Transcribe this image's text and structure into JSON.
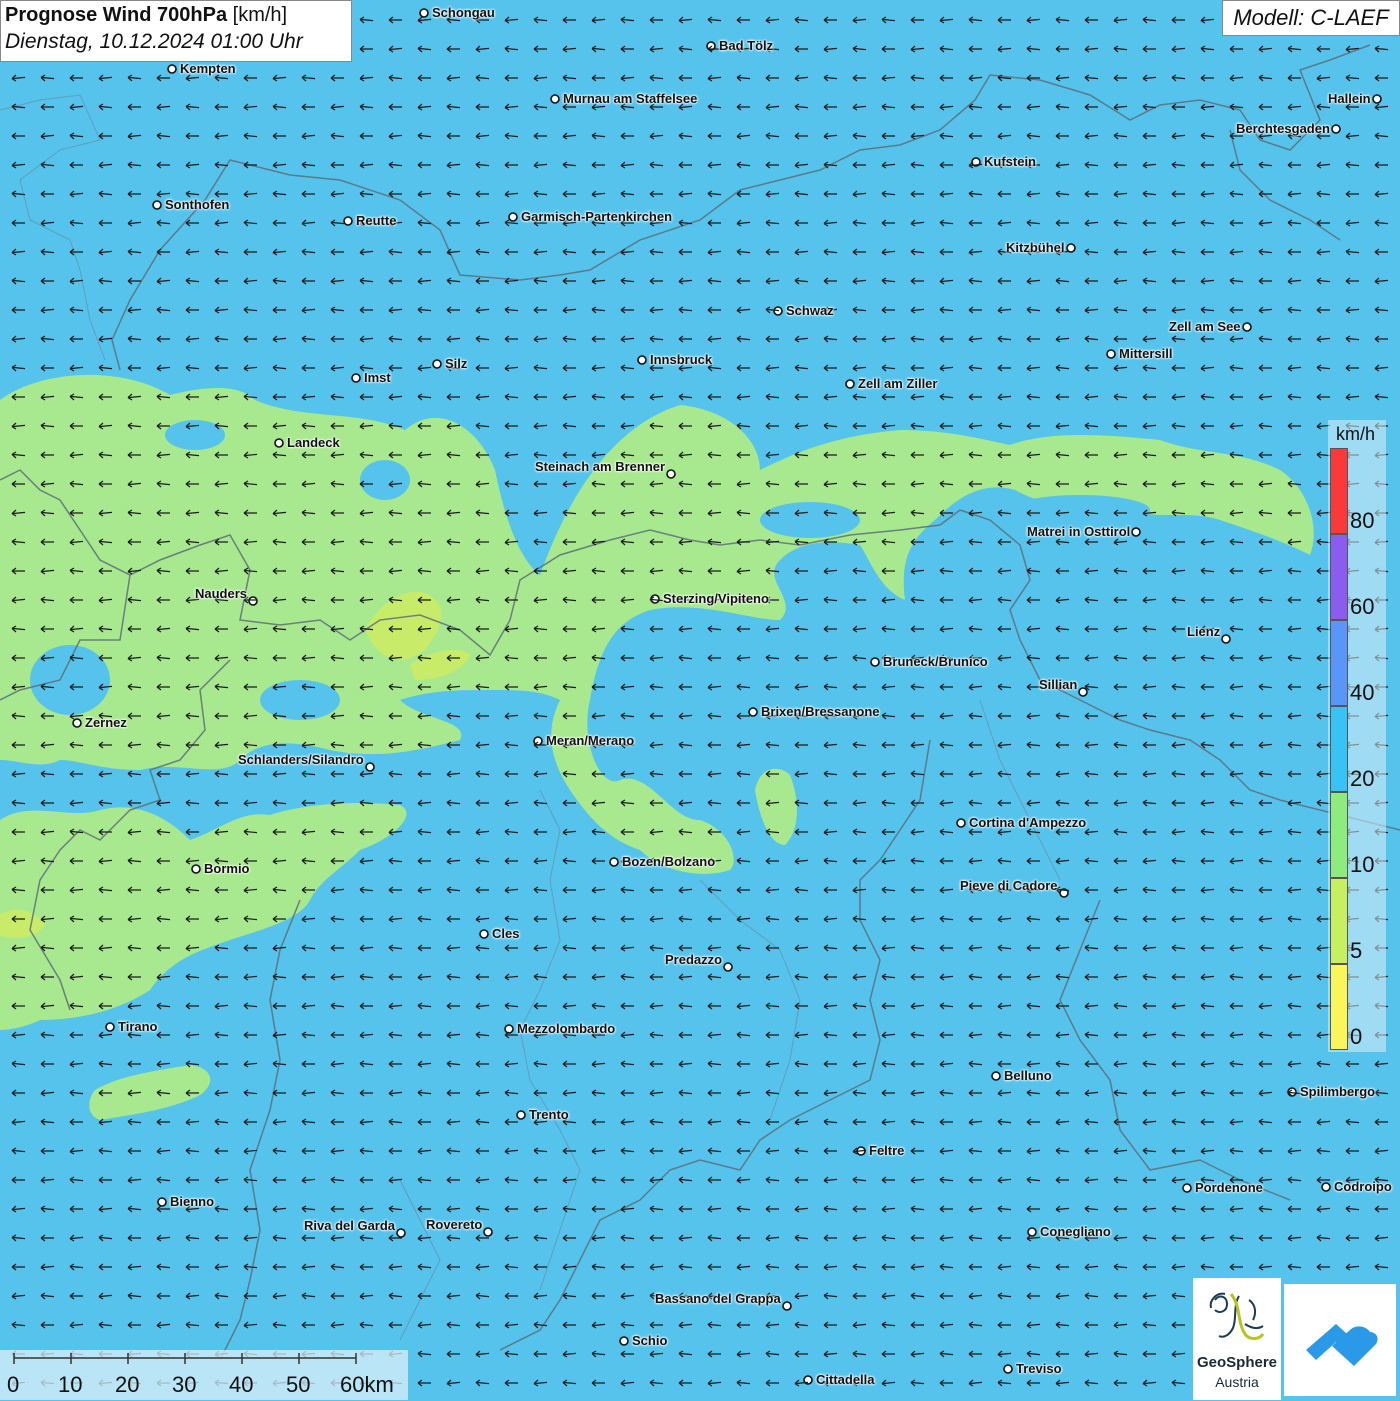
{
  "header": {
    "title_bold": "Prognose Wind 700hPa",
    "title_unit": "[km/h]",
    "date": "Dienstag, 10.12.2024 01:00 Uhr",
    "model": "Modell: C-LAEF"
  },
  "map": {
    "wind_direction": "west",
    "field_colors": {
      "speed_20_40": "#55c3ec",
      "speed_10_20": "#a8e88e",
      "speed_5_10": "#c8ec6a"
    },
    "cities": [
      {
        "name": "Schongau",
        "side": "right"
      },
      {
        "name": "Bad Tölz",
        "side": "right"
      },
      {
        "name": "Kempten",
        "side": "right"
      },
      {
        "name": "Murnau am Staffelsee",
        "side": "right"
      },
      {
        "name": "Hallein",
        "side": "left"
      },
      {
        "name": "Berchtesgaden",
        "side": "left"
      },
      {
        "name": "Kufstein",
        "side": "right"
      },
      {
        "name": "Sonthofen",
        "side": "right"
      },
      {
        "name": "Reutte",
        "side": "right"
      },
      {
        "name": "Garmisch-Partenkirchen",
        "side": "right"
      },
      {
        "name": "Kitzbühel",
        "side": "left"
      },
      {
        "name": "Schwaz",
        "side": "right"
      },
      {
        "name": "Zell am See",
        "side": "left"
      },
      {
        "name": "Mittersill",
        "side": "right"
      },
      {
        "name": "Innsbruck",
        "side": "right"
      },
      {
        "name": "Silz",
        "side": "right"
      },
      {
        "name": "Imst",
        "side": "right"
      },
      {
        "name": "Zell am Ziller",
        "side": "right"
      },
      {
        "name": "Landeck",
        "side": "right"
      },
      {
        "name": "Steinach am Brenner",
        "side": "left"
      },
      {
        "name": "Matrei in Osttirol",
        "side": "left"
      },
      {
        "name": "Nauders",
        "side": "left"
      },
      {
        "name": "Sterzing/Vipiteno",
        "side": "right"
      },
      {
        "name": "Lienz",
        "side": "left"
      },
      {
        "name": "Bruneck/Brunico",
        "side": "right"
      },
      {
        "name": "Sillian",
        "side": "left"
      },
      {
        "name": "Brixen/Bressanone",
        "side": "right"
      },
      {
        "name": "Zernez",
        "side": "right"
      },
      {
        "name": "Meran/Merano",
        "side": "right"
      },
      {
        "name": "Schlanders/Silandro",
        "side": "left"
      },
      {
        "name": "Cortina d'Ampezzo",
        "side": "right"
      },
      {
        "name": "Bozen/Bolzano",
        "side": "right"
      },
      {
        "name": "Bormio",
        "side": "right"
      },
      {
        "name": "Pieve di Cadore",
        "side": "left"
      },
      {
        "name": "Cles",
        "side": "right"
      },
      {
        "name": "Predazzo",
        "side": "left"
      },
      {
        "name": "Tirano",
        "side": "right"
      },
      {
        "name": "Mezzolombardo",
        "side": "right"
      },
      {
        "name": "Belluno",
        "side": "right"
      },
      {
        "name": "Spilimbergo",
        "side": "right"
      },
      {
        "name": "Trento",
        "side": "right"
      },
      {
        "name": "Feltre",
        "side": "right"
      },
      {
        "name": "Pordenone",
        "side": "right"
      },
      {
        "name": "Codroipo",
        "side": "right"
      },
      {
        "name": "Bienno",
        "side": "right"
      },
      {
        "name": "Riva del Garda",
        "side": "left"
      },
      {
        "name": "Rovereto",
        "side": "left"
      },
      {
        "name": "Conegliano",
        "side": "right"
      },
      {
        "name": "Bassano del Grappa",
        "side": "left"
      },
      {
        "name": "Schio",
        "side": "right"
      },
      {
        "name": "Treviso",
        "side": "right"
      },
      {
        "name": "Cittadella",
        "side": "right"
      }
    ]
  },
  "legend": {
    "unit": "km/h",
    "segments": [
      {
        "color": "#fa3a3a"
      },
      {
        "color": "#8a5cf0"
      },
      {
        "color": "#5a96f8"
      },
      {
        "color": "#38c3f5"
      },
      {
        "color": "#8eeb7e"
      },
      {
        "color": "#c6f060"
      },
      {
        "color": "#fbf55c"
      }
    ],
    "labels": [
      "80",
      "60",
      "40",
      "20",
      "10",
      "5",
      "0"
    ]
  },
  "scalebar": {
    "labels": [
      "0",
      "10",
      "20",
      "30",
      "40",
      "50",
      "60km"
    ]
  },
  "logos": {
    "geosphere_line1": "GeoSphere",
    "geosphere_line2": "Austria"
  }
}
